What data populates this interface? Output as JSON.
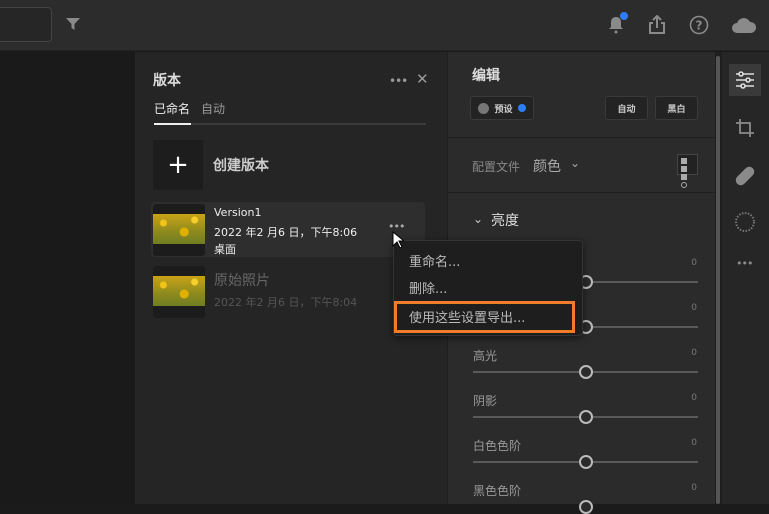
{
  "versions_panel": {
    "title": "版本",
    "tabs": [
      {
        "label": "已命名",
        "active": true
      },
      {
        "label": "自动",
        "active": false
      }
    ],
    "create_label": "创建版本",
    "items": [
      {
        "name": "Version1",
        "date": "2022 年2 月6 日，下午8:06",
        "location": "桌面"
      },
      {
        "name": "原始照片",
        "date": "2022 年2 月6 日，下午8:04"
      }
    ]
  },
  "context_menu": {
    "items": [
      "重命名...",
      "删除...",
      "使用这些设置导出..."
    ],
    "highlight_color": "#f07c2a"
  },
  "edit_panel": {
    "title": "编辑",
    "preset_label": "预设",
    "auto_label": "自动",
    "bw_label": "黑白",
    "profile_label": "配置文件",
    "profile_value": "颜色",
    "section": "亮度",
    "sliders": [
      {
        "label": "",
        "value": "0"
      },
      {
        "label": "",
        "value": "0"
      },
      {
        "label": "高光",
        "value": "0"
      },
      {
        "label": "阴影",
        "value": "0"
      },
      {
        "label": "白色色阶",
        "value": "0"
      },
      {
        "label": "黑色色阶",
        "value": "0"
      }
    ]
  },
  "accent_color": "#2d7ff9"
}
